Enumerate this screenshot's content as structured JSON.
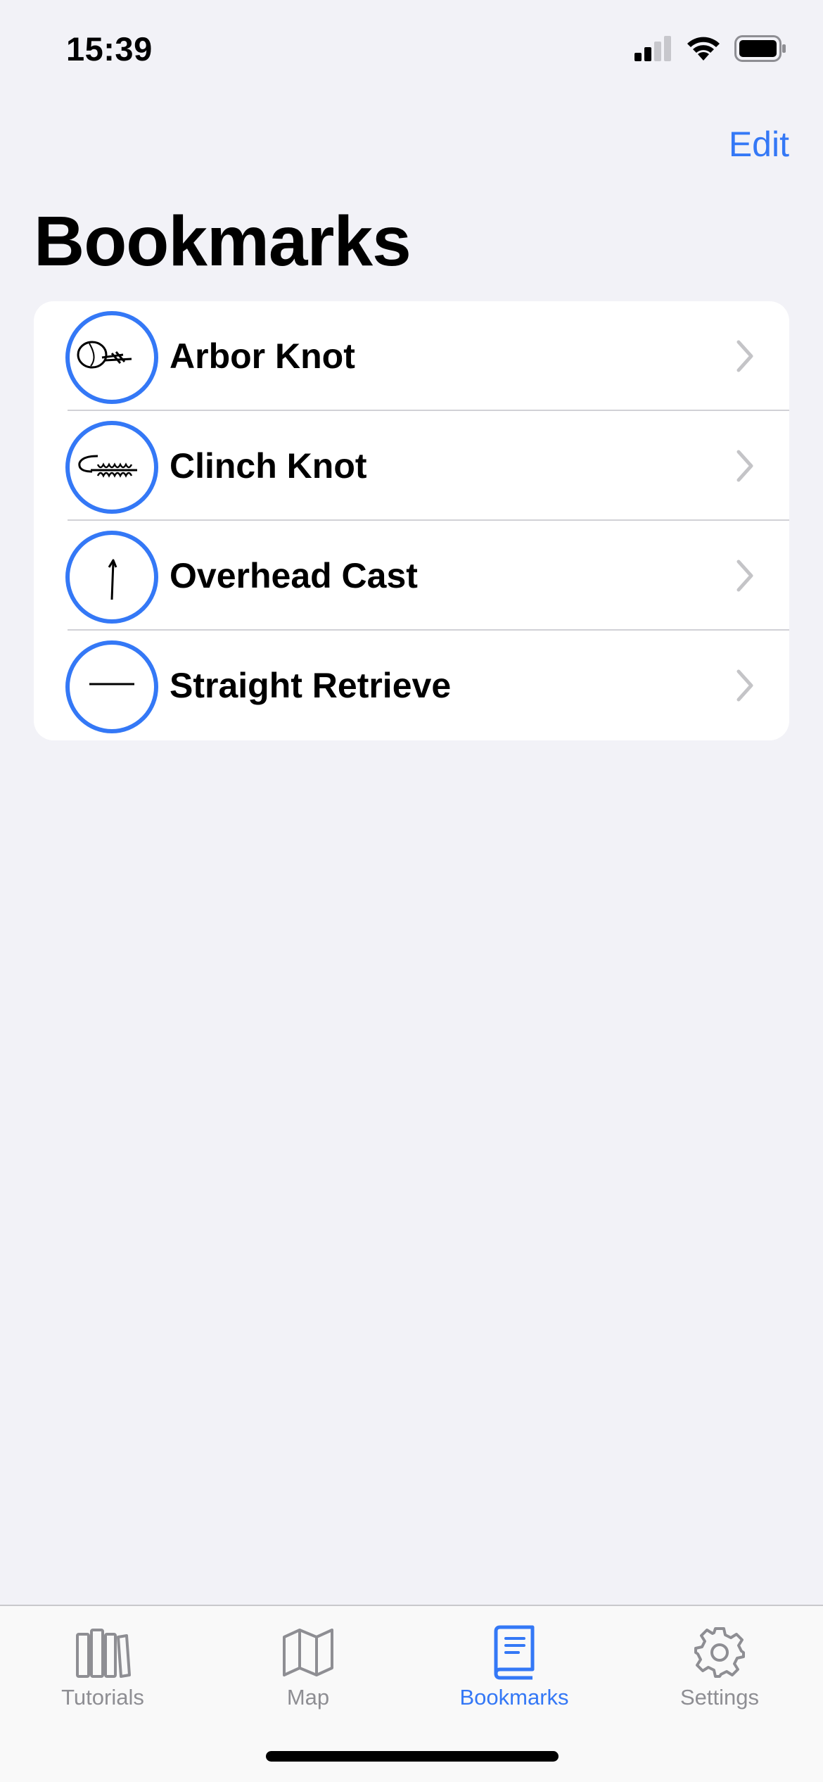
{
  "status_bar": {
    "time": "15:39"
  },
  "nav": {
    "edit_label": "Edit",
    "title": "Bookmarks"
  },
  "bookmarks": [
    {
      "label": "Arbor Knot",
      "icon": "arbor-knot-icon"
    },
    {
      "label": "Clinch Knot",
      "icon": "clinch-knot-icon"
    },
    {
      "label": "Overhead Cast",
      "icon": "overhead-cast-icon"
    },
    {
      "label": "Straight Retrieve",
      "icon": "straight-retrieve-icon"
    }
  ],
  "tabs": [
    {
      "label": "Tutorials",
      "icon": "books-icon",
      "active": false
    },
    {
      "label": "Map",
      "icon": "map-icon",
      "active": false
    },
    {
      "label": "Bookmarks",
      "icon": "book-icon",
      "active": true
    },
    {
      "label": "Settings",
      "icon": "gear-icon",
      "active": false
    }
  ],
  "colors": {
    "accent": "#3478F6",
    "background": "#F2F2F7",
    "inactive": "#8E8E93"
  }
}
